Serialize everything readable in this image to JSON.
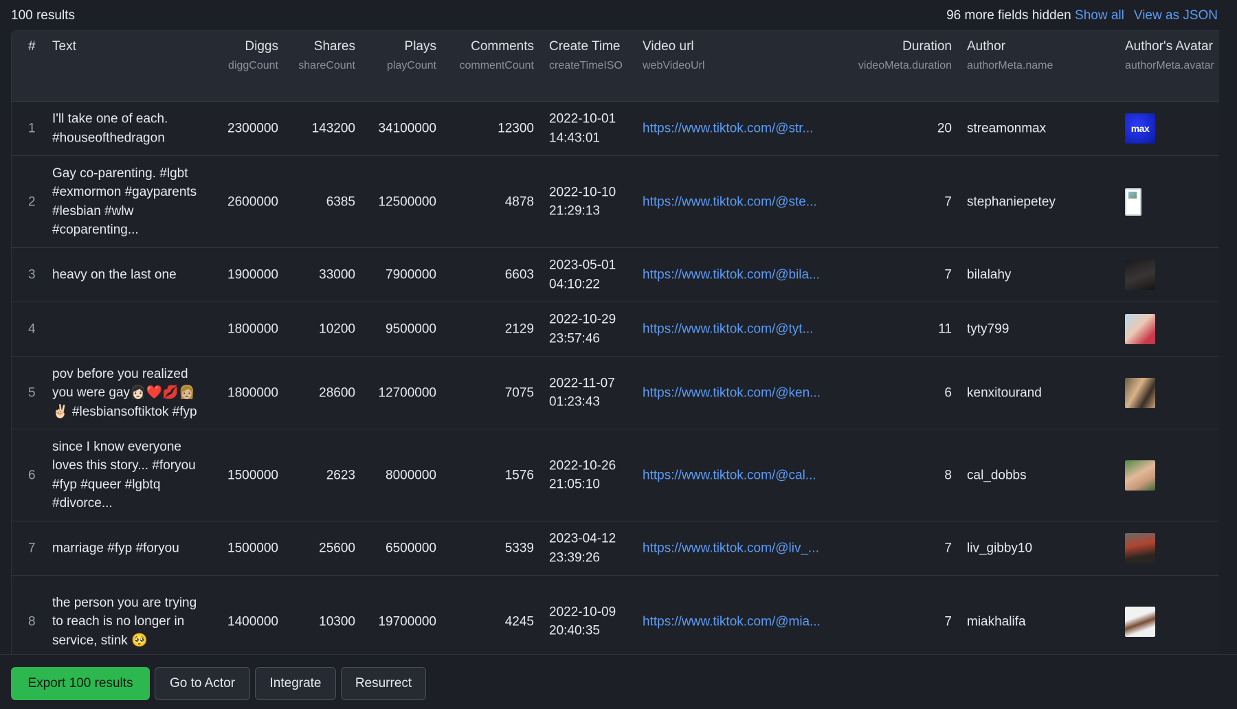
{
  "summary": {
    "results_count": "100 results",
    "hidden_fields": "96 more fields hidden",
    "show_all": "Show all",
    "view_json": "View as JSON"
  },
  "columns": {
    "index": {
      "label": "#"
    },
    "text": {
      "label": "Text"
    },
    "diggs": {
      "label": "Diggs",
      "key": "diggCount"
    },
    "shares": {
      "label": "Shares",
      "key": "shareCount"
    },
    "plays": {
      "label": "Plays",
      "key": "playCount"
    },
    "comments": {
      "label": "Comments",
      "key": "commentCount"
    },
    "create_time": {
      "label": "Create Time",
      "key": "createTimeISO"
    },
    "video_url": {
      "label": "Video url",
      "key": "webVideoUrl"
    },
    "duration": {
      "label": "Duration",
      "key": "videoMeta.duration"
    },
    "author": {
      "label": "Author",
      "key": "authorMeta.name"
    },
    "avatar": {
      "label": "Author's Avatar",
      "key": "authorMeta.avatar"
    }
  },
  "rows": [
    {
      "index": "1",
      "text": "I'll take one of each. #houseofthedragon",
      "diggs": "2300000",
      "shares": "143200",
      "plays": "34100000",
      "comments": "12300",
      "date": "2022-10-01",
      "time": "14:43:01",
      "url": "https://www.tiktok.com/@str...",
      "duration": "20",
      "author": "streamonmax",
      "avatar_text": "max"
    },
    {
      "index": "2",
      "text": "Gay co-parenting. #lgbt #exmormon #gayparents #lesbian #wlw #coparenting...",
      "diggs": "2600000",
      "shares": "6385",
      "plays": "12500000",
      "comments": "4878",
      "date": "2022-10-10",
      "time": "21:29:13",
      "url": "https://www.tiktok.com/@ste...",
      "duration": "7",
      "author": "stephaniepetey"
    },
    {
      "index": "3",
      "text": "heavy on the last one",
      "diggs": "1900000",
      "shares": "33000",
      "plays": "7900000",
      "comments": "6603",
      "date": "2023-05-01",
      "time": "04:10:22",
      "url": "https://www.tiktok.com/@bila...",
      "duration": "7",
      "author": "bilalahy"
    },
    {
      "index": "4",
      "text": "",
      "diggs": "1800000",
      "shares": "10200",
      "plays": "9500000",
      "comments": "2129",
      "date": "2022-10-29",
      "time": "23:57:46",
      "url": "https://www.tiktok.com/@tyt...",
      "duration": "11",
      "author": "tyty799"
    },
    {
      "index": "5",
      "text": "pov before you realized you were gay👩🏻❤️💋👩🏼✌🏻 #lesbiansoftiktok #fyp",
      "diggs": "1800000",
      "shares": "28600",
      "plays": "12700000",
      "comments": "7075",
      "date": "2022-11-07",
      "time": "01:23:43",
      "url": "https://www.tiktok.com/@ken...",
      "duration": "6",
      "author": "kenxitourand"
    },
    {
      "index": "6",
      "text": "since I know everyone loves this story... #foryou #fyp #queer #lgbtq #divorce...",
      "diggs": "1500000",
      "shares": "2623",
      "plays": "8000000",
      "comments": "1576",
      "date": "2022-10-26",
      "time": "21:05:10",
      "url": "https://www.tiktok.com/@cal...",
      "duration": "8",
      "author": "cal_dobbs"
    },
    {
      "index": "7",
      "text": "marriage #fyp #foryou",
      "diggs": "1500000",
      "shares": "25600",
      "plays": "6500000",
      "comments": "5339",
      "date": "2023-04-12",
      "time": "23:39:26",
      "url": "https://www.tiktok.com/@liv_...",
      "duration": "7",
      "author": "liv_gibby10"
    },
    {
      "index": "8",
      "text": "the person you are trying to reach is no longer in service, stink 🥺",
      "diggs": "1400000",
      "shares": "10300",
      "plays": "19700000",
      "comments": "4245",
      "date": "2022-10-09",
      "time": "20:40:35",
      "url": "https://www.tiktok.com/@mia...",
      "duration": "7",
      "author": "miakhalifa"
    }
  ],
  "actions": {
    "export": "Export 100 results",
    "go_to_actor": "Go to Actor",
    "integrate": "Integrate",
    "resurrect": "Resurrect"
  },
  "colors": {
    "accent": "#2db84f",
    "link": "#5b9cf5",
    "background": "#1c1f26",
    "header": "#262a33"
  }
}
